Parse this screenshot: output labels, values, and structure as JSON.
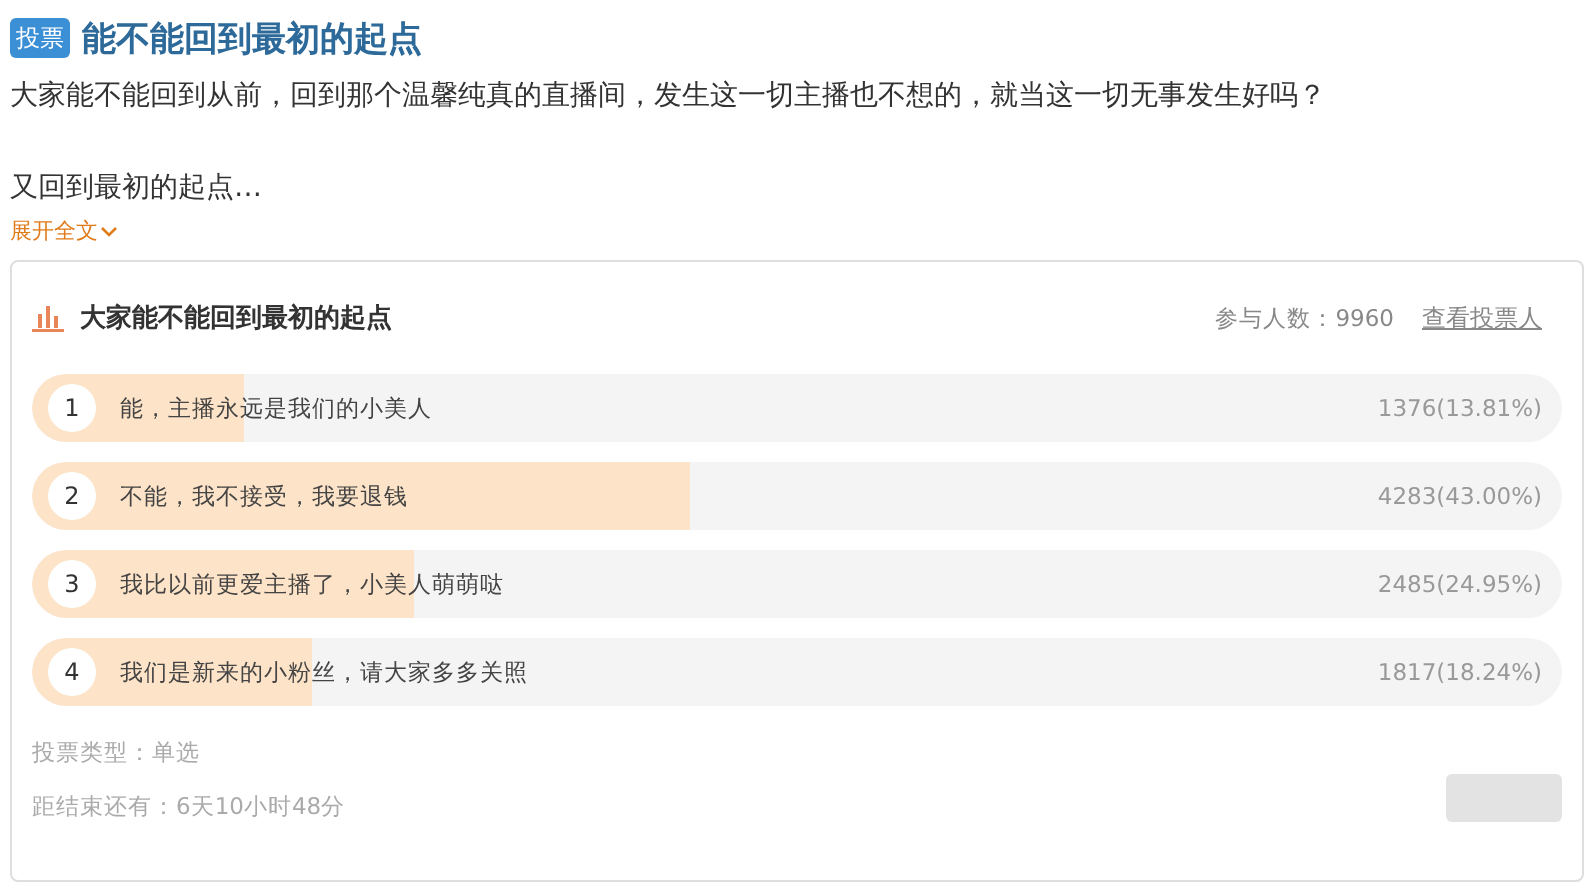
{
  "post": {
    "tag": "投票",
    "title": "能不能回到最初的起点",
    "paragraphs": [
      "大家能不能回到从前，回到那个温馨纯真的直播间，发生这一切主播也不想的，就当这一切无事发生好吗？",
      "又回到最初的起点…"
    ],
    "expand_link": "展开全文"
  },
  "poll": {
    "title": "大家能不能回到最初的起点",
    "participants": "参与人数：9960",
    "voters_link": "查看投票人",
    "options": [
      {
        "number": "1",
        "label": "能，主播永远是我们的小美人",
        "result": "1376(13.81%)",
        "level": 0.1381
      },
      {
        "number": "2",
        "label": "不能，我不接受，我要退钱",
        "result": "4283(43.00%)",
        "level": 0.43
      },
      {
        "number": "3",
        "label": "我比以前更爱主播了，小美人萌萌哒",
        "result": "2485(24.95%)",
        "level": 0.2495
      },
      {
        "number": "4",
        "label": "我们是新来的小粉丝，请大家多多关照",
        "result": "1817(18.24%)",
        "level": 0.1824
      }
    ],
    "vote_type": "投票类型：单选",
    "time_left": "距结束还有：6天10小时48分"
  }
}
